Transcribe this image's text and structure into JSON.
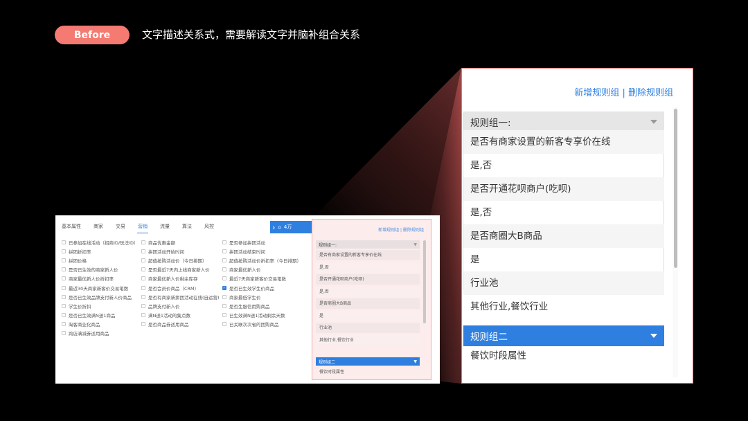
{
  "badge": "Before",
  "headline": "文字描述关系式，需要解读文字并脑补组合关系",
  "small": {
    "tabs": [
      {
        "label": "基本属性"
      },
      {
        "label": "商家"
      },
      {
        "label": "交易"
      },
      {
        "label": "营销",
        "active": true
      },
      {
        "label": "流量"
      },
      {
        "label": "算法"
      },
      {
        "label": "风控"
      }
    ],
    "count_label": "4万",
    "columns": [
      [
        "已参加在线活动（招商ID/玩法ID）",
        "拼团折扣率",
        "拼团价格",
        "是否已生效的商家新人价",
        "商家最优新人价折扣率",
        "最近30天商家新客价交易笔数",
        "是否已生效品牌支付新人价商品",
        "学生价折扣",
        "是否已生效满N送1商品",
        "淘客商业化商品",
        "跨店满减券适用商品"
      ],
      [
        "商品优惠金额",
        "拼团活动开始时间",
        "超值抢购活动价（今日排期）",
        "是否最近7天内上线商家新人价",
        "商家最优新人价剩余库存",
        "是否会员价商品（CRM）",
        "是否有商家新拼团活动在线(自运营)",
        "品牌支付新人价",
        "满N送1活动的集点数",
        "是否商品券适用商品"
      ],
      [
        "是否参加拼团活动",
        "拼团活动结束时间",
        "超值抢购活动价折扣率（今日排期）",
        "商家最优新人价",
        "最近7天商家新客价交易笔数",
        "是否已生效学生价商品",
        "商家最低学生价",
        "是否生服信用购商品",
        "已生效满N送1活动剩余天数",
        "已关联次次省的团购商品"
      ]
    ],
    "checked_item": "是否已生效学生价商品",
    "panel": {
      "add_group": "新增规则组",
      "separator": "|",
      "delete_group": "删除规则组",
      "group1": "规则组一:",
      "items": [
        "是否有商家设置的新客专享价在线",
        "是,否",
        "是否开通花呗商户(吃呗)",
        "是,否",
        "是否商圈大B商品",
        "是",
        "行业池",
        "其他行业,餐饮行业"
      ],
      "group2": "规则组二",
      "group2_items": [
        "餐饮时段属性"
      ]
    }
  },
  "zoom": {
    "add_group": "新增规则组",
    "separator": "|",
    "delete_group": "删除规则组",
    "group1": "规则组一:",
    "items": [
      "是否有商家设置的新客专享价在线",
      "是,否",
      "是否开通花呗商户(吃呗)",
      "是,否",
      "是否商圈大B商品",
      "是",
      "行业池",
      "其他行业,餐饮行业"
    ],
    "group2": "规则组二",
    "group2_items": [
      "餐饮时段属性"
    ]
  },
  "colors": {
    "accent_blue": "#2f7fe0",
    "badge_red": "#f47a72",
    "highlight_border": "#f26e6e"
  }
}
